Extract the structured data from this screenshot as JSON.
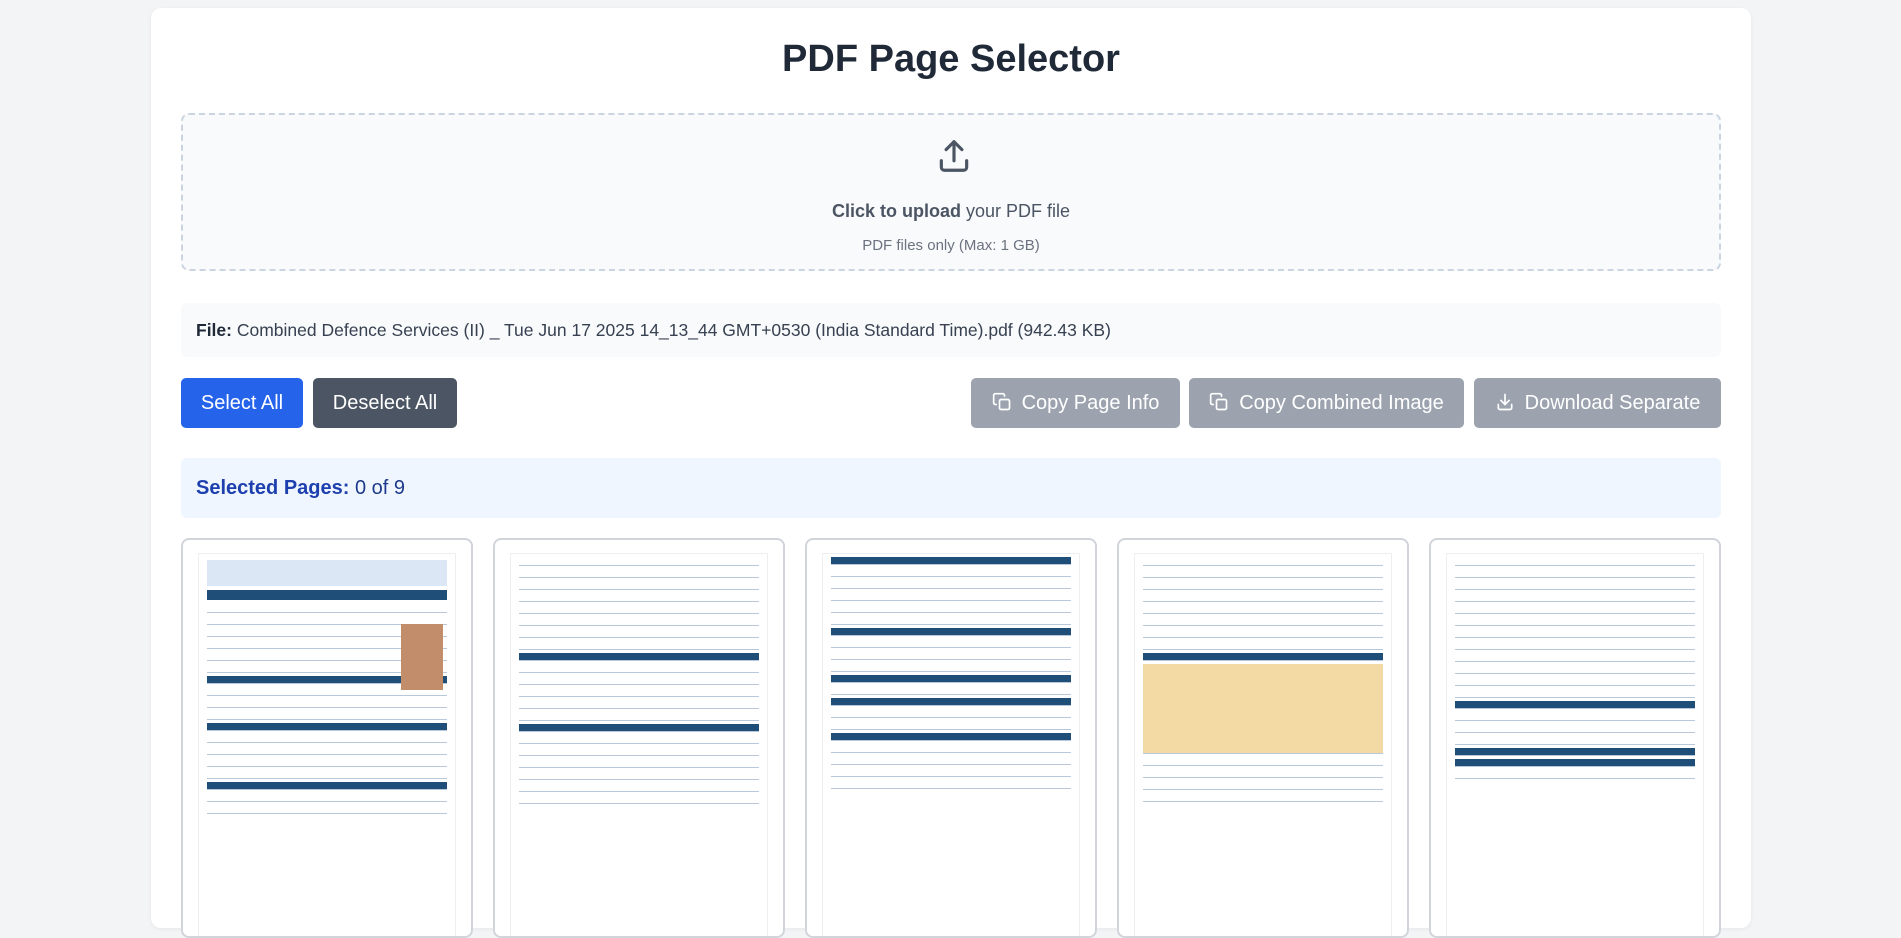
{
  "title": "PDF Page Selector",
  "upload": {
    "icon": "upload-icon",
    "click_text": "Click to upload",
    "rest_text": "your PDF file",
    "hint": "PDF files only (Max: 1 GB)"
  },
  "file": {
    "label": "File:",
    "name": "Combined Defence Services (II) _ Tue Jun 17 2025 14_13_44 GMT+0530 (India Standard Time).pdf (942.43 KB)"
  },
  "buttons": {
    "select_all": "Select All",
    "deselect_all": "Deselect All",
    "copy_page_info": "Copy Page Info",
    "copy_combined_image": "Copy Combined Image",
    "download_separate": "Download Separate"
  },
  "selection": {
    "label": "Selected Pages:",
    "value": "0 of 9"
  },
  "colors": {
    "primary": "#2563eb",
    "dark": "#4b5563",
    "disabled": "#9ca3af",
    "selected_bg": "#eff6ff"
  }
}
